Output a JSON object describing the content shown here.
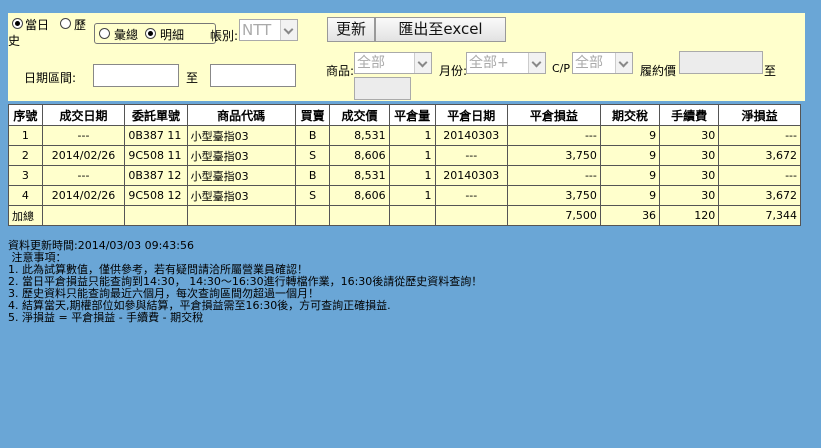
{
  "filter": {
    "radio_today": "當日",
    "radio_history_line1": "歷",
    "radio_history_line2": "史",
    "radio_summary": "彙總",
    "radio_detail": "明細",
    "account_label": "帳別:",
    "account_value": "NTT",
    "refresh_label": "更新",
    "export_label": "匯出至excel",
    "date_range_label": "日期區間:",
    "to_label": "至",
    "product_label": "商品:",
    "product_value": "全部",
    "month_label": "月份:",
    "month_value": "全部+",
    "cp_label": "C/P",
    "cp_value": "全部",
    "strike_label": "履約價",
    "strike_to_label": "至"
  },
  "table": {
    "headers": [
      "序號",
      "成交日期",
      "委託單號",
      "商品代碼",
      "買賣",
      "成交價",
      "平倉量",
      "平倉日期",
      "平倉損益",
      "期交稅",
      "手續費",
      "淨損益"
    ],
    "rows": [
      [
        "1",
        "---",
        "0B387 11",
        "小型臺指03",
        "B",
        "8,531",
        "1",
        "20140303",
        "---",
        "9",
        "30",
        "---"
      ],
      [
        "2",
        "2014/02/26",
        "9C508 11",
        "小型臺指03",
        "S",
        "8,606",
        "1",
        "---",
        "3,750",
        "9",
        "30",
        "3,672"
      ],
      [
        "3",
        "---",
        "0B387 12",
        "小型臺指03",
        "B",
        "8,531",
        "1",
        "20140303",
        "---",
        "9",
        "30",
        "---"
      ],
      [
        "4",
        "2014/02/26",
        "9C508 12",
        "小型臺指03",
        "S",
        "8,606",
        "1",
        "---",
        "3,750",
        "9",
        "30",
        "3,672"
      ]
    ],
    "total": {
      "label": "加總",
      "pnl": "7,500",
      "tax": "36",
      "fee": "120",
      "net": "7,344"
    }
  },
  "notes": {
    "update_time": "資料更新時間:2014/03/03 09:43:56",
    "title": " 注意事項：",
    "items": [
      "1. 此為試算數值，僅供參考，若有疑問請洽所屬營業員確認！",
      "2. 當日平倉損益只能查詢到14:30， 14:30～16:30進行轉檔作業，16:30後請從歷史資料查詢！",
      "3. 歷史資料只能查詢最近六個月，每次查詢區間勿超過一個月！",
      "4. 結算當天,期權部位如參與結算，平倉損益需至16:30後，方可查詢正確損益.",
      "5. 淨損益 = 平倉損益 - 手續費 - 期交稅"
    ]
  }
}
